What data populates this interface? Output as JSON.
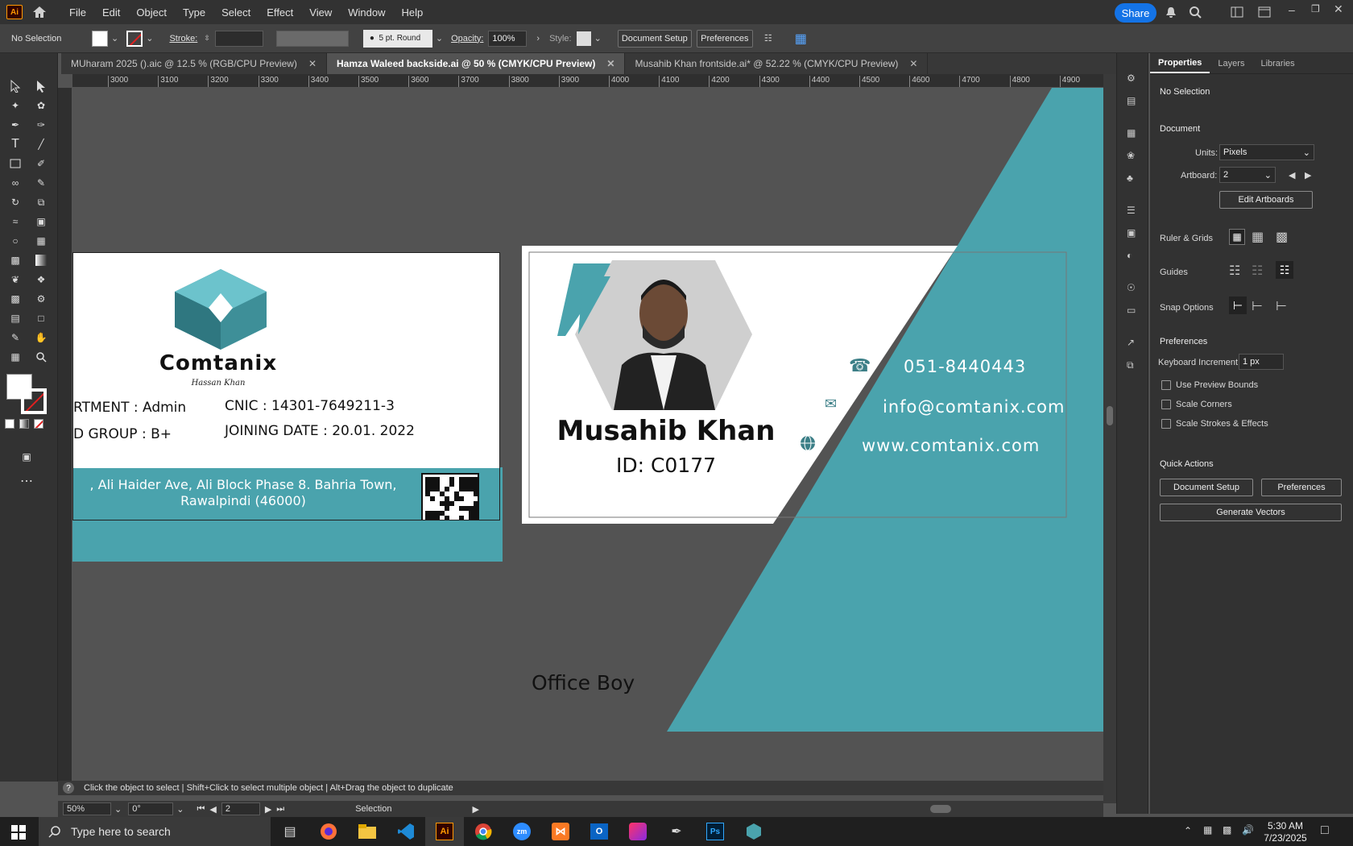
{
  "app": {
    "logo": "Ai",
    "menus": [
      "File",
      "Edit",
      "Object",
      "Type",
      "Select",
      "Effect",
      "View",
      "Window",
      "Help"
    ],
    "share": "Share"
  },
  "control": {
    "selection": "No Selection",
    "stroke": "Stroke:",
    "brush": "5 pt. Round",
    "opacity_label": "Opacity:",
    "opacity": "100%",
    "style_label": "Style:",
    "doc_setup": "Document Setup",
    "preferences": "Preferences"
  },
  "tabs": [
    {
      "label": "MUharam 2025 ().aic @ 12.5 % (RGB/CPU Preview)"
    },
    {
      "label": "Hamza Waleed backside.ai @ 50 % (CMYK/CPU Preview)"
    },
    {
      "label": "Musahib Khan  frontside.ai* @ 52.22 % (CMYK/CPU Preview)"
    }
  ],
  "ruler": {
    "marks": [
      "3000",
      "3100",
      "3200",
      "3300",
      "3400",
      "3500",
      "3600",
      "3700",
      "3800",
      "3900",
      "4000",
      "4100",
      "4200",
      "4300",
      "4400",
      "4500",
      "4600",
      "4700",
      "4800",
      "4900"
    ]
  },
  "back_card": {
    "company": "Comtanix",
    "signature": "Hassan Khan",
    "department": "RTMENT : Admin",
    "blood": "D GROUP : B+",
    "cnic": "CNIC : 14301-7649211-3",
    "joining": "JOINING DATE : 20.01. 2022",
    "address_line1": ", Ali Haider Ave, Ali Block Phase 8. Bahria Town,",
    "address_line2": "Rawalpindi (46000)"
  },
  "front_card": {
    "name": "Musahib Khan",
    "id": "ID: C0177",
    "phone": "051-8440443",
    "email": "info@comtanix.com",
    "website": "www.comtanix.com",
    "role": "Office Boy"
  },
  "status": {
    "hint": "Click the object to select  |  Shift+Click to select multiple object  |  Alt+Drag the object to duplicate",
    "zoom": "50%",
    "rotate": "0°",
    "artboard": "2",
    "mode": "Selection"
  },
  "panel": {
    "tabs": [
      "Properties",
      "Layers",
      "Libraries"
    ],
    "no_selection": "No Selection",
    "document": "Document",
    "units_label": "Units:",
    "units": "Pixels",
    "artboard_label": "Artboard:",
    "artboard": "2",
    "edit_artboards": "Edit Artboards",
    "ruler_grids": "Ruler & Grids",
    "guides": "Guides",
    "snap": "Snap Options",
    "preferences": "Preferences",
    "kb_label": "Keyboard Increment:",
    "kb": "1 px",
    "use_preview": "Use Preview Bounds",
    "scale_corners": "Scale Corners",
    "scale_strokes": "Scale Strokes & Effects",
    "quick_actions": "Quick Actions",
    "doc_setup": "Document Setup",
    "prefs_btn": "Preferences",
    "gen_vectors": "Generate Vectors"
  },
  "taskbar": {
    "search": "Type here to search",
    "time": "5:30 AM",
    "date": "7/23/2025"
  },
  "colors": {
    "teal": "#4aa3ad",
    "accent": "#1473e6"
  }
}
